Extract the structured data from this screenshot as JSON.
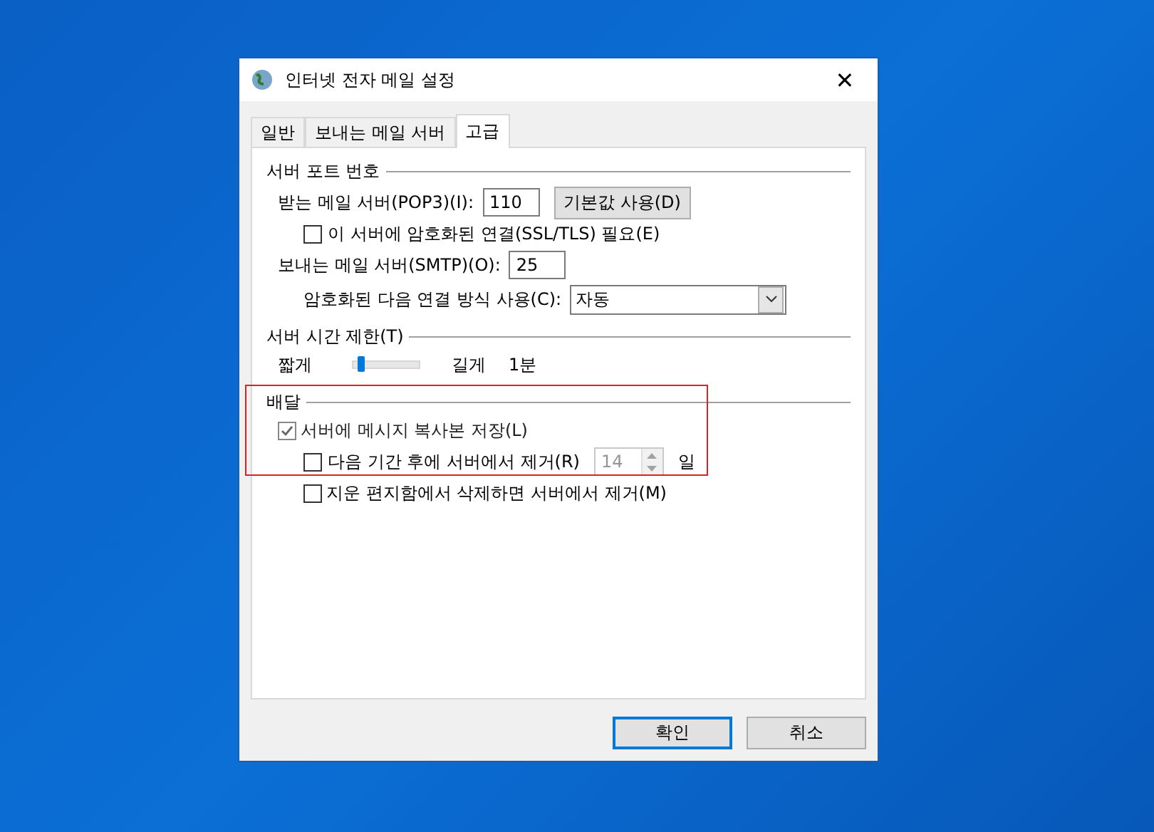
{
  "window": {
    "title": "인터넷 전자 메일 설정",
    "close": "✕"
  },
  "tabs": [
    {
      "label": "일반",
      "selected": false
    },
    {
      "label": "보내는 메일 서버",
      "selected": false
    },
    {
      "label": "고급",
      "selected": true
    }
  ],
  "server_ports": {
    "heading": "서버 포트 번호",
    "incoming": {
      "label": "받는 메일 서버(POP3)(I):",
      "value": "110",
      "default_button": "기본값 사용(D)"
    },
    "ssl": {
      "label": "이 서버에 암호화된 연결(SSL/TLS) 필요(E)",
      "checked": false
    },
    "outgoing": {
      "label": "보내는 메일 서버(SMTP)(O):",
      "value": "25"
    },
    "encryption": {
      "label": "암호화된 다음 연결 방식 사용(C):",
      "value": "자동"
    }
  },
  "timeout": {
    "heading": "서버 시간 제한(T)",
    "short": "짧게",
    "long": "길게",
    "reading": "1분",
    "level": 0.1
  },
  "delivery": {
    "heading": "배달",
    "options": [
      {
        "kind": "check",
        "label": "서버에 메시지 복사본 저장(L)",
        "checked": true,
        "disabled": true
      },
      {
        "kind": "days",
        "label": "다음 기간 후에 서버에서 제거(R)",
        "checked": false,
        "value": "14",
        "unit": "일"
      },
      {
        "kind": "check",
        "label": "지운 편지함에서 삭제하면 서버에서 제거(M)",
        "checked": false,
        "disabled": false
      }
    ]
  },
  "buttons": [
    {
      "label": "확인",
      "default": true
    },
    {
      "label": "취소",
      "default": false
    }
  ]
}
